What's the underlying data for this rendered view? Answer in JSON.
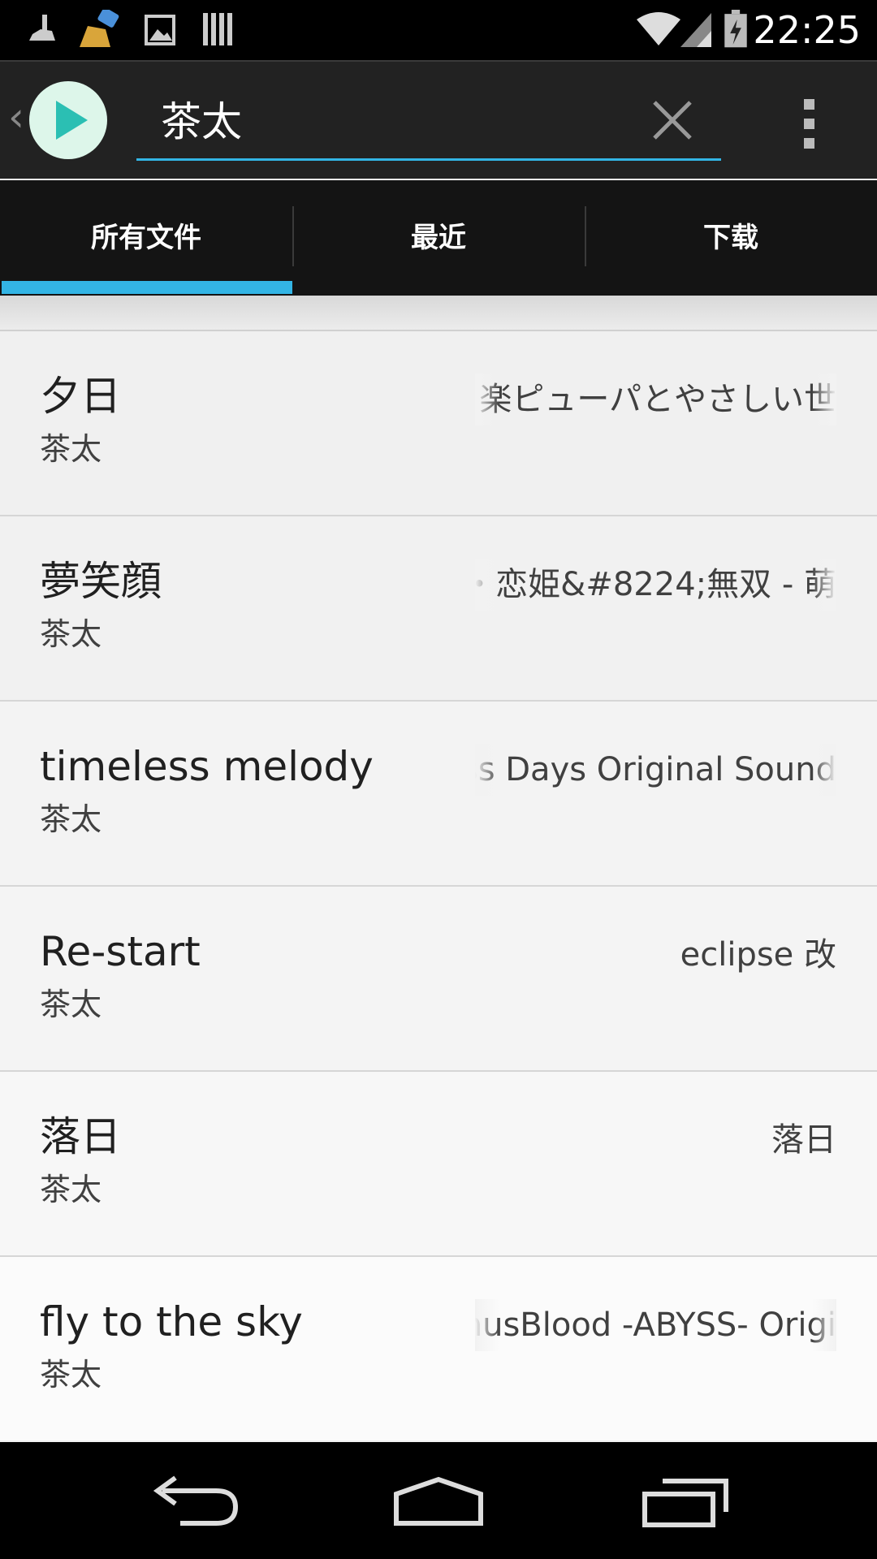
{
  "status_bar": {
    "time": "22:25",
    "left_icons": [
      "cleaner-icon",
      "broom-icon",
      "image-icon",
      "barcode-icon"
    ],
    "right_icons": [
      "wifi-icon",
      "signal-icon",
      "battery-charging-icon"
    ]
  },
  "action_bar": {
    "search_value": "茶太",
    "accent": "#33b5e5",
    "logo_color": "#2bbfb3"
  },
  "tabs": [
    {
      "label": "所有文件",
      "selected": true
    },
    {
      "label": "最近",
      "selected": false
    },
    {
      "label": "下载",
      "selected": false
    }
  ],
  "songs": [
    {
      "title": "夕日",
      "artist": "茶太",
      "album": "楽ピューパとやさしい世"
    },
    {
      "title": "夢笑顔",
      "artist": "茶太",
      "album": "・恋姫&#8224;無双 - 萌"
    },
    {
      "title": "timeless melody",
      "artist": "茶太",
      "album": "oss Days Original Sound"
    },
    {
      "title": "Re-start",
      "artist": "茶太",
      "album": "eclipse 改"
    },
    {
      "title": "落日",
      "artist": "茶太",
      "album": "落日"
    },
    {
      "title": "fly to the sky",
      "artist": "茶太",
      "album": "nusBlood -ABYSS- Origi"
    }
  ],
  "nav_bar": {
    "icons": [
      "back-icon",
      "home-icon",
      "recent-apps-icon"
    ]
  }
}
